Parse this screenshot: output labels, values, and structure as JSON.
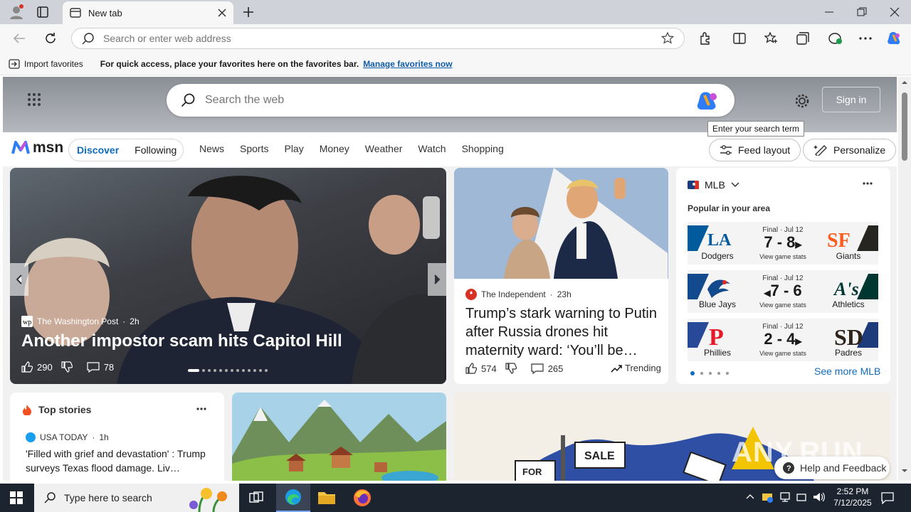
{
  "browser": {
    "tab_title": "New tab",
    "address_placeholder": "Search or enter web address",
    "fav_import": "Import favorites",
    "fav_message": "For quick access, place your favorites here on the favorites bar.",
    "fav_link": "Manage favorites now"
  },
  "msn": {
    "search_placeholder": "Search the web",
    "sign_in": "Sign in",
    "tooltip": "Enter your search term",
    "logo_text": "msn",
    "tabs": [
      "Discover",
      "Following"
    ],
    "nav": [
      "News",
      "Sports",
      "Play",
      "Money",
      "Weather",
      "Watch",
      "Shopping"
    ],
    "feed_layout": "Feed layout",
    "personalize": "Personalize"
  },
  "hero_story": {
    "source": "The Washington Post",
    "age": "2h",
    "headline": "Another impostor scam hits Capitol Hill",
    "likes": "290",
    "comments": "78"
  },
  "second_story": {
    "source": "The Independent",
    "age": "23h",
    "headline": "Trump’s stark warning to Putin after Russia drones hit maternity ward: ‘You’ll be…",
    "likes": "574",
    "comments": "265",
    "trending": "Trending"
  },
  "mlb": {
    "title": "MLB",
    "subtitle": "Popular in your area",
    "see_more": "See more MLB",
    "games": [
      {
        "status": "Final · Jul 12",
        "score": "7 - 8",
        "home": "Dodgers",
        "away": "Giants",
        "link": "View game stats",
        "home_color": "#005a9c",
        "away_color": "#fd5a1e"
      },
      {
        "status": "Final · Jul 12",
        "score": "7 - 6",
        "home": "Blue Jays",
        "away": "Athletics",
        "link": "View game stats",
        "home_color": "#134a8e",
        "away_color": "#003831"
      },
      {
        "status": "Final · Jul 12",
        "score": "2 - 4",
        "home": "Phillies",
        "away": "Padres",
        "link": "View game stats",
        "home_color": "#e81828",
        "away_color": "#2f241d"
      }
    ]
  },
  "top_stories": {
    "title": "Top stories",
    "source": "USA TODAY",
    "age": "1h",
    "headline": "'Filled with grief and devastation' : Trump surveys Texas flood damage. Liv…"
  },
  "help": "Help and Feedback",
  "watermark": "ANY.RUN",
  "taskbar": {
    "search_placeholder": "Type here to search",
    "time": "2:52 PM",
    "date": "7/12/2025"
  }
}
